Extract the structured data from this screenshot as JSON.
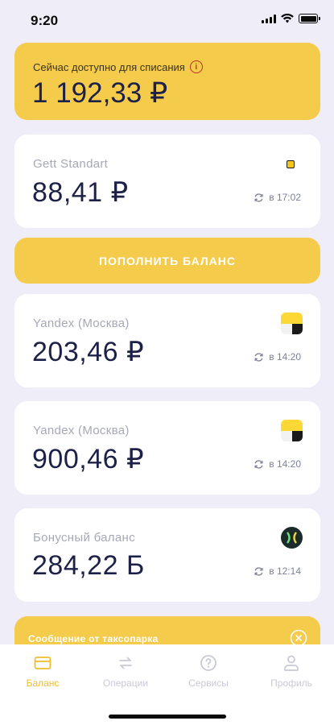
{
  "status_bar": {
    "time": "9:20"
  },
  "available": {
    "label": "Сейчас доступно для списания",
    "amount": "1 192,33 ₽"
  },
  "accounts": [
    {
      "title": "Gett Standart",
      "amount": "88,41 ₽",
      "updated": "в 17:02",
      "logo": "gett-logo"
    },
    {
      "title": "Yandex (Москва)",
      "amount": "203,46 ₽",
      "updated": "в 14:20",
      "logo": "yandex-logo"
    },
    {
      "title": "Yandex (Москва)",
      "amount": "900,46 ₽",
      "updated": "в 14:20",
      "logo": "yandex-logo"
    },
    {
      "title": "Бонусный баланс",
      "amount": "284,22 Б",
      "updated": "в 12:14",
      "logo": "bonus-logo"
    }
  ],
  "topup_button": "ПОПОЛНИТЬ БАЛАНС",
  "message": {
    "title": "Сообщение от таксопарка"
  },
  "tabs": [
    {
      "label": "Баланс",
      "icon": "card-icon",
      "active": true
    },
    {
      "label": "Операции",
      "icon": "transfer-icon",
      "active": false
    },
    {
      "label": "Сервисы",
      "icon": "help-icon",
      "active": false
    },
    {
      "label": "Профиль",
      "icon": "person-icon",
      "active": false
    }
  ],
  "colors": {
    "accent": "#f5cb4b",
    "background": "#efeef8",
    "text": "#1e2147",
    "muted": "#a6a8b8",
    "active_tab": "#eebe2e"
  }
}
